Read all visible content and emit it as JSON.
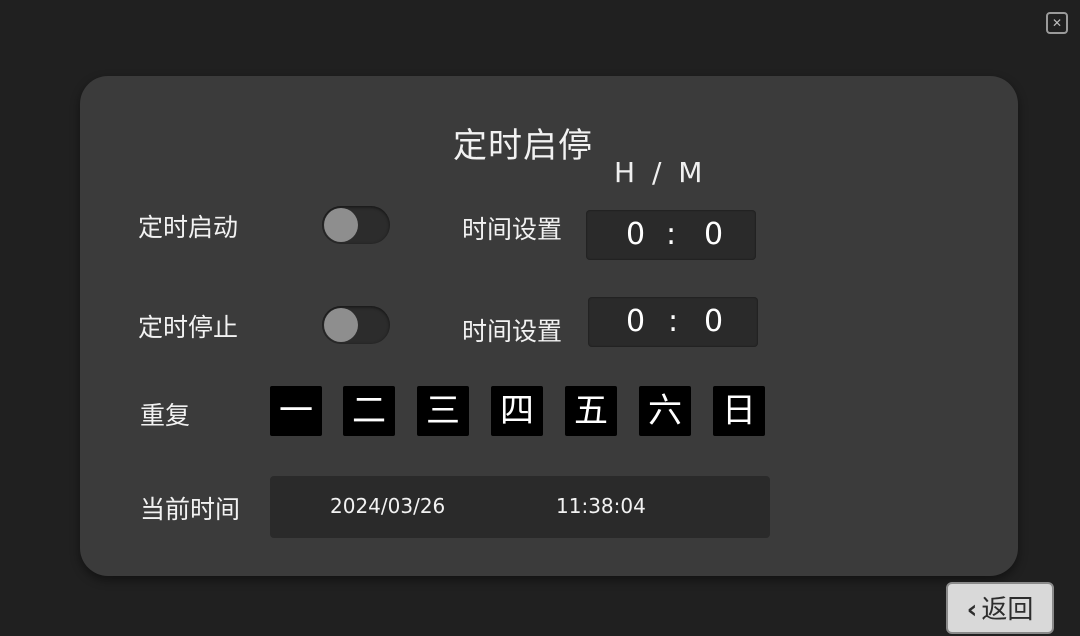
{
  "title": "定时启停",
  "hm_header": "H / M",
  "timed_start": {
    "label": "定时启动",
    "time_label": "时间设置",
    "hour": "0",
    "separator": ":",
    "minute": "0"
  },
  "timed_stop": {
    "label": "定时停止",
    "time_label": "时间设置",
    "hour": "0",
    "separator": ":",
    "minute": "0"
  },
  "repeat": {
    "label": "重复",
    "days": [
      "一",
      "二",
      "三",
      "四",
      "五",
      "六",
      "日"
    ]
  },
  "current_time": {
    "label": "当前时间",
    "date": "2024/03/26",
    "time": "11:38:04"
  },
  "back_button": {
    "label": "返回",
    "icon": "chevron-left-icon"
  },
  "corner_icon": "close-icon",
  "colors": {
    "background": "#202020",
    "panel": "#3b3b3b",
    "day_box": "#000000"
  }
}
